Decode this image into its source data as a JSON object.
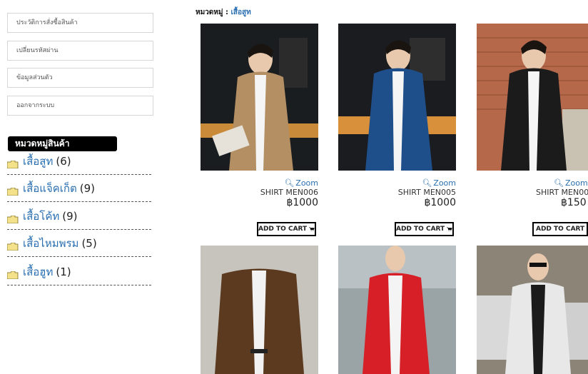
{
  "menu": [
    {
      "label": "ประวัติการสั่งซื้อสินค้า"
    },
    {
      "label": "เปลี่ยนรหัสผ่าน"
    },
    {
      "label": "ข้อมูลส่วนตัว"
    },
    {
      "label": "ออกจากระบบ"
    }
  ],
  "categories": {
    "header": "หมวดหมู่สินค้า",
    "items": [
      {
        "name": "เสื้อสูท",
        "count": "(6)"
      },
      {
        "name": "เสื้อแจ็คเก็ต",
        "count": "(9)"
      },
      {
        "name": "เสื้อโค้ท",
        "count": "(9)"
      },
      {
        "name": "เสื้อไหมพรม",
        "count": "(5)"
      },
      {
        "name": "เสื้อฮูท",
        "count": "(1)"
      }
    ]
  },
  "breadcrumb": {
    "label": "หมวดหมู่ :",
    "value": "เสื้อสูท"
  },
  "products": [
    {
      "zoom": "Zoom",
      "code": "SHIRT MEN006",
      "price": "฿1000",
      "cart": "ADD TO CART",
      "jacket": "#b38f63"
    },
    {
      "zoom": "Zoom",
      "code": "SHIRT MEN005",
      "price": "฿1000",
      "cart": "ADD TO CART",
      "jacket": "#1f4f8a"
    },
    {
      "zoom": "Zoom",
      "code": "SHIRT MEN00",
      "price": "฿150",
      "cart": "ADD TO CART",
      "jacket": "#1b1b1b"
    },
    {
      "jacket": "#5b3a1f"
    },
    {
      "jacket": "#d61f26"
    },
    {
      "jacket": "#e8e8e8"
    }
  ],
  "colors": {
    "link": "#2a6fb0",
    "header_bg": "#000000"
  }
}
